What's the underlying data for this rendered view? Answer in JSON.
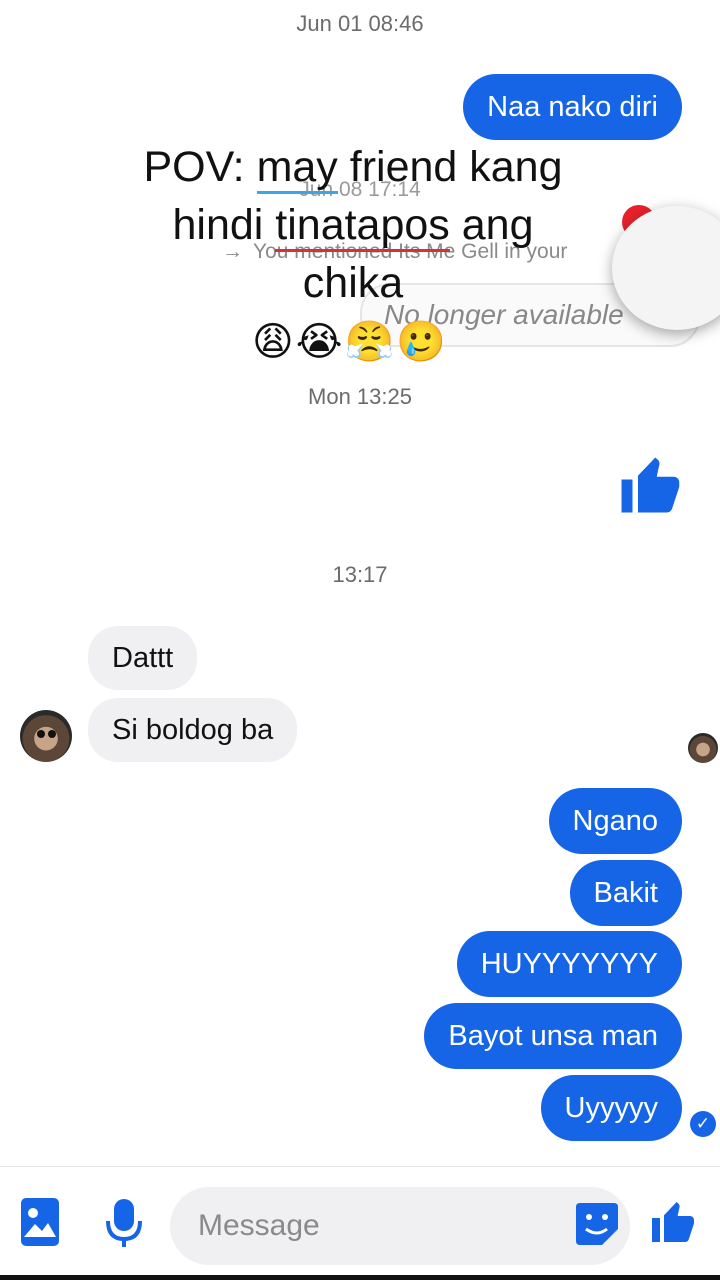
{
  "timestamps": {
    "first": "Jun 01 08:46",
    "reply_meta_time": "Jun 08 17:14",
    "second": "Mon 13:25",
    "third": "13:17"
  },
  "overlay": {
    "line1_prefix": "POV: ",
    "line1_underlined": "may",
    "line1_rest": " friend kang",
    "line2_prefix": "hindi ",
    "line2_underlined": "tinatapos",
    "line2_rest": " ang",
    "line3": "chika",
    "emojis": "😩😭😤🥲"
  },
  "reply_context": {
    "arrow": "→",
    "text": "You mentioned Its Me Gell in your",
    "unavailable_text": "No longer available"
  },
  "messages_outgoing_top": [
    "Naa nako diri"
  ],
  "messages_incoming": [
    "Dattt",
    "Si boldog ba"
  ],
  "messages_outgoing": [
    "Ngano",
    "Bakit",
    "HUYYYYYYY",
    "Bayot unsa man",
    "Uyyyyy"
  ],
  "composer": {
    "placeholder": "Message",
    "icons": [
      "gallery-icon",
      "microphone-icon",
      "sticker-icon",
      "thumbs-up-icon"
    ]
  },
  "colors": {
    "accent": "#1565e6",
    "incoming_bubble": "#f0f0f2",
    "timestamp": "#6b6b6b"
  }
}
